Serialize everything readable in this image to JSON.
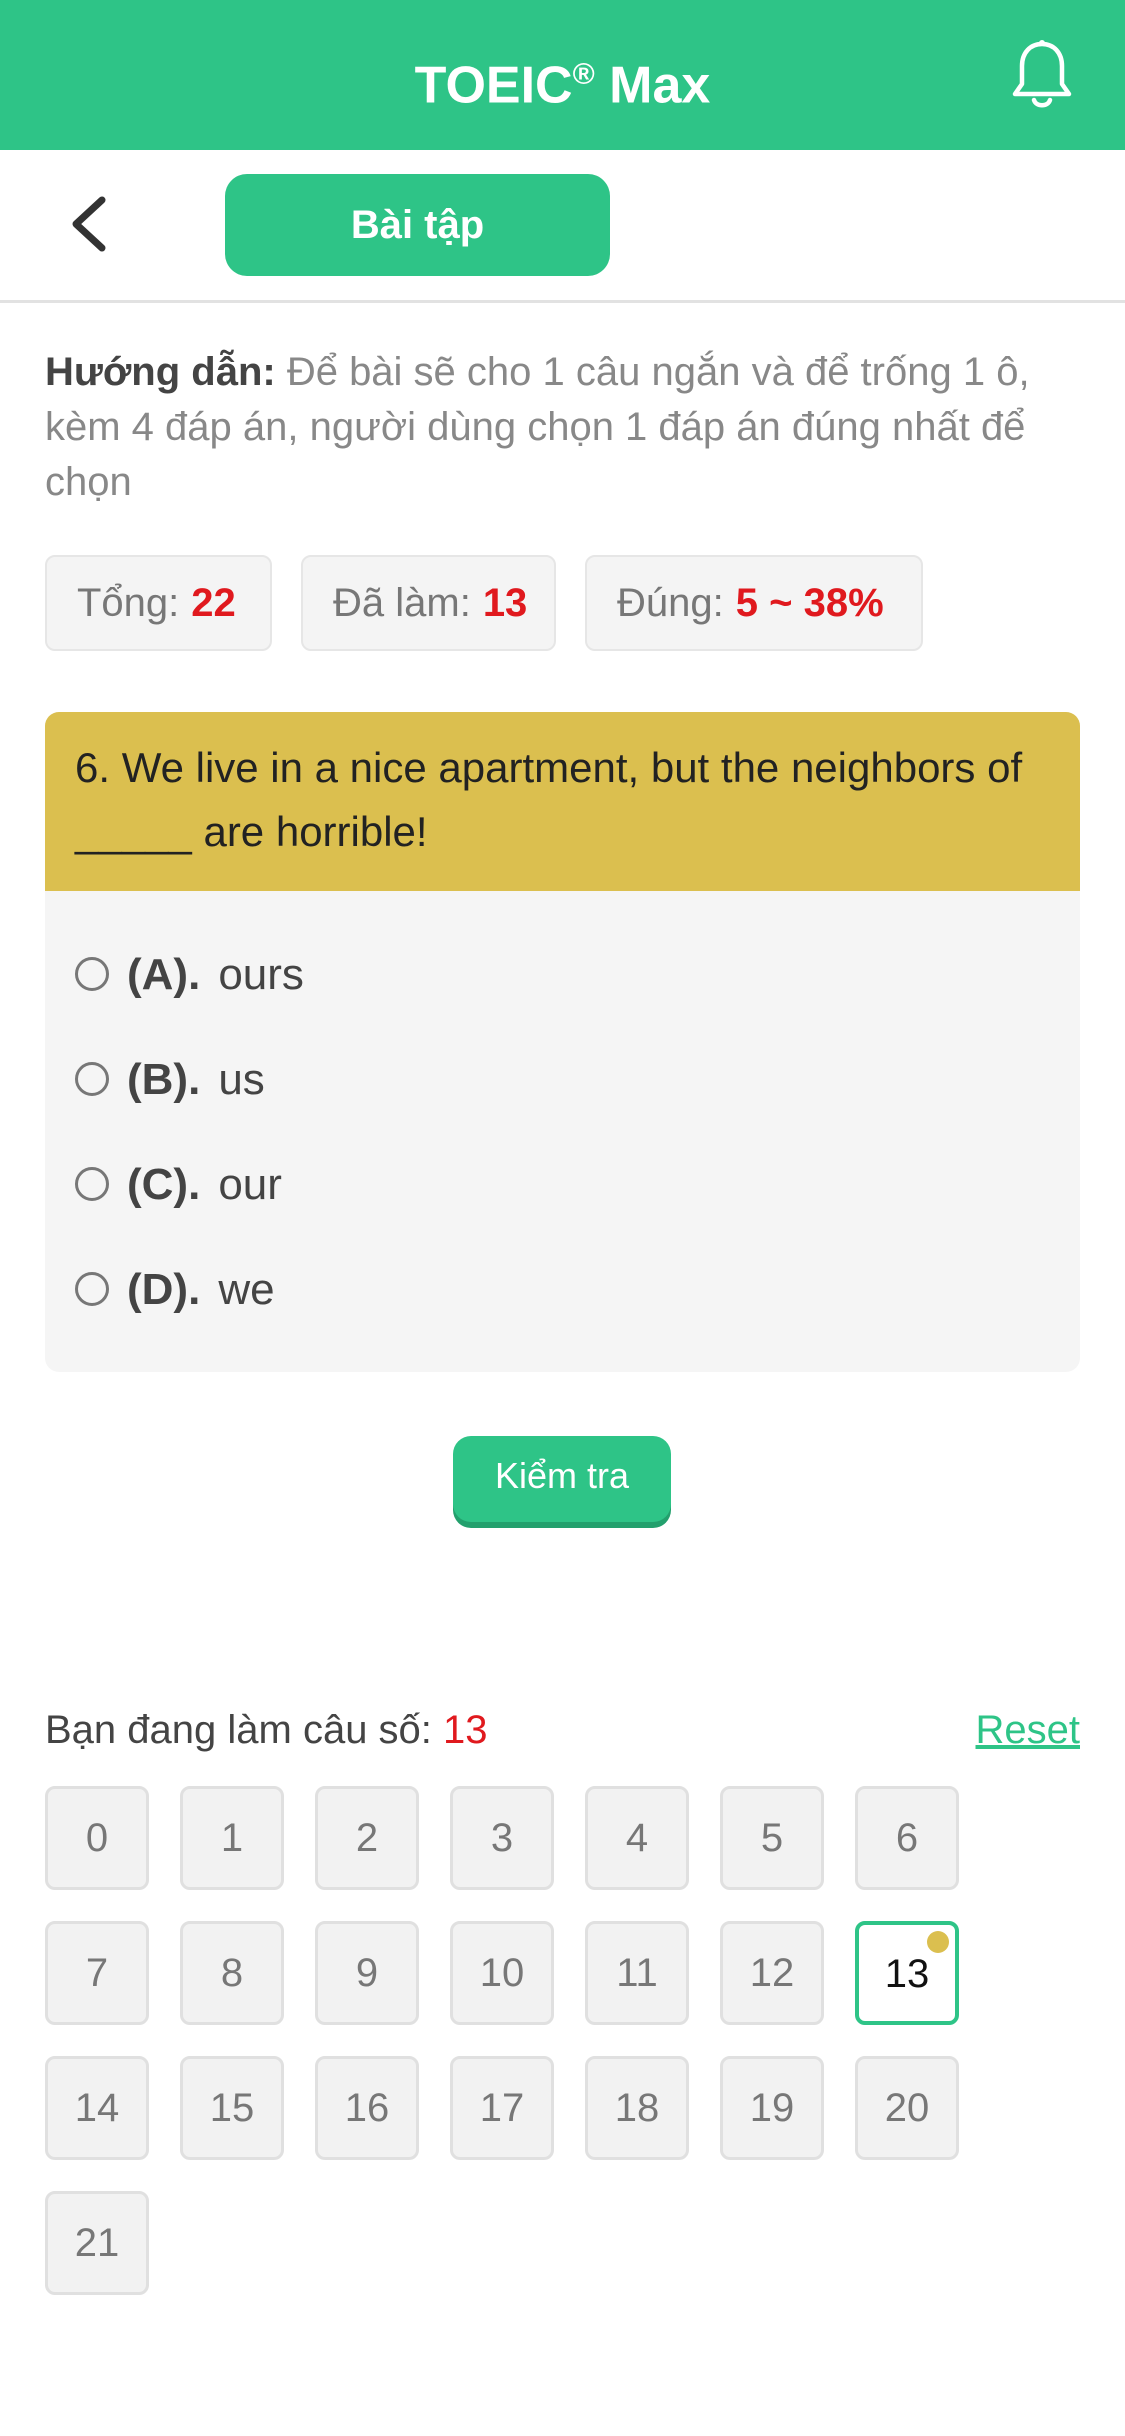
{
  "header": {
    "title": "TOEIC",
    "title_mark": "®",
    "title_suffix": " Max",
    "bell_icon": "bell-icon",
    "background": "#2ec487"
  },
  "subbar": {
    "back_icon": "chevron-left-icon",
    "tab_label": "Bài tập"
  },
  "guide": {
    "label": "Hướng dẫn:",
    "text": " Để bài sẽ cho 1 câu ngắn và để trống 1 ô, kèm 4 đáp án, người dùng chọn 1 đáp án đúng nhất để chọn"
  },
  "stats": {
    "total_label": "Tổng:",
    "total_value": "22",
    "done_label": "Đã làm:",
    "done_value": "13",
    "correct_label": "Đúng:",
    "correct_value": "5 ~ 38%"
  },
  "question": {
    "text": "6. We live in a nice apartment, but the neighbors of _____ are horrible!",
    "options": [
      {
        "letter": "(A).",
        "text": "ours"
      },
      {
        "letter": "(B).",
        "text": "us"
      },
      {
        "letter": "(C).",
        "text": "our"
      },
      {
        "letter": "(D).",
        "text": "we"
      }
    ],
    "header_color": "#dbbf4f"
  },
  "check_button": "Kiểm tra",
  "navigator": {
    "current_label": "Bạn đang làm câu số:",
    "current_value": "13",
    "reset_label": "Reset",
    "numbers": [
      "0",
      "1",
      "2",
      "3",
      "4",
      "5",
      "6",
      "7",
      "8",
      "9",
      "10",
      "11",
      "12",
      "13",
      "14",
      "15",
      "16",
      "17",
      "18",
      "19",
      "20",
      "21"
    ],
    "active": "13"
  }
}
